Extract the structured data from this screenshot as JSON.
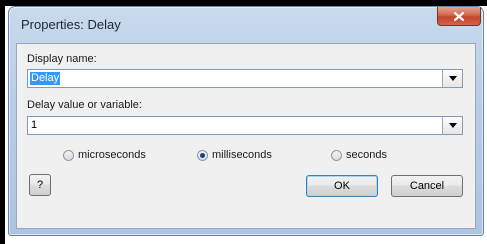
{
  "window": {
    "title": "Properties: Delay",
    "close_label": "X"
  },
  "display_name": {
    "label": "Display name:",
    "value": "Delay"
  },
  "delay_value": {
    "label": "Delay value or variable:",
    "value": "1"
  },
  "units": {
    "selected": "milliseconds",
    "options": [
      "microseconds",
      "milliseconds",
      "seconds"
    ]
  },
  "buttons": {
    "help": "?",
    "ok": "OK",
    "cancel": "Cancel"
  },
  "icons": {
    "close": "close-icon",
    "dropdown": "chevron-down-icon"
  }
}
